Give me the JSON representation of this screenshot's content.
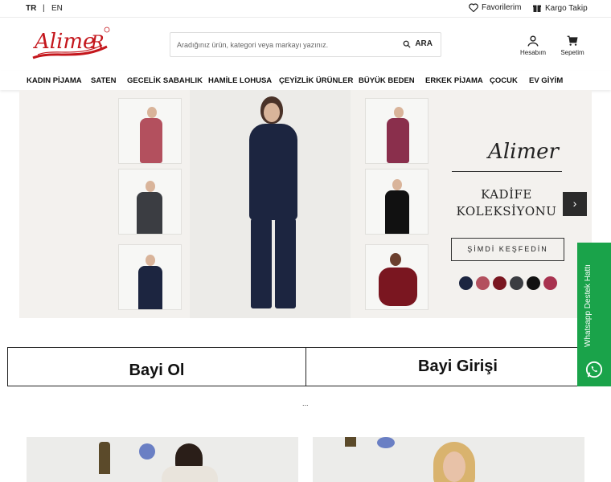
{
  "topbar": {
    "lang_tr": "TR",
    "lang_sep": "|",
    "lang_en": "EN",
    "favorites": "Favorilerim",
    "cargo": "Kargo Takip"
  },
  "header": {
    "logo_text": "Alimer",
    "search_placeholder": "Aradığınız ürün, kategori veya markayı yazınız.",
    "search_button": "ARA",
    "account": "Hesabım",
    "cart": "Sepetim"
  },
  "nav": [
    "KADIN PİJAMA",
    "SATEN",
    "GECELİK SABAHLIK",
    "HAMİLE LOHUSA",
    "ÇEYİZLİK ÜRÜNLER",
    "BÜYÜK BEDEN",
    "ERKEK PİJAMA",
    "ÇOCUK",
    "EV GİYİM"
  ],
  "hero": {
    "brand": "Alimer",
    "title_line1": "KADİFE",
    "title_line2": "KOLEKSİYONU",
    "cta": "ŞİMDİ KEŞFEDİN",
    "swatches": [
      "#1c2540",
      "#b3505e",
      "#7a1620",
      "#3b3d42",
      "#111111",
      "#a8324f"
    ],
    "next_icon": "chevron-right-icon"
  },
  "dealer": {
    "become": "Bayi Ol",
    "login": "Bayi Girişi",
    "dots": "..."
  },
  "whatsapp": {
    "label": "Whatsapp Destek Hattı",
    "color": "#1aa34a"
  }
}
